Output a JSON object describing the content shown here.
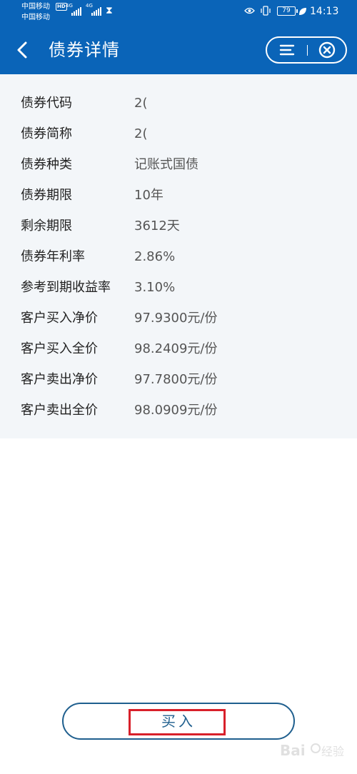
{
  "status_bar": {
    "carrier_1": "中国移动",
    "carrier_1_badge": "HD",
    "carrier_2": "中国移动",
    "signal_1_label": "4G",
    "signal_2_label": "4G",
    "battery_level": "79",
    "time": "14:13"
  },
  "header": {
    "title": "债券详情",
    "background_color": "#0a64b8",
    "icons": [
      "back-arrow-icon",
      "menu-icon",
      "close-circle-icon"
    ]
  },
  "bond_details": {
    "rows": [
      {
        "label": "债券代码",
        "value": "2("
      },
      {
        "label": "债券简称",
        "value": "2("
      },
      {
        "label": "债券种类",
        "value": "记账式国债"
      },
      {
        "label": "债券期限",
        "value": "10年"
      },
      {
        "label": "剩余期限",
        "value": "3612天"
      },
      {
        "label": "债券年利率",
        "value": "2.86%"
      },
      {
        "label": "参考到期收益率",
        "value": "3.10%"
      },
      {
        "label": "客户买入净价",
        "value": "97.9300元/份"
      },
      {
        "label": "客户买入全价",
        "value": "98.2409元/份"
      },
      {
        "label": "客户卖出净价",
        "value": "97.7800元/份"
      },
      {
        "label": "客户卖出全价",
        "value": "98.0909元/份"
      }
    ]
  },
  "actions": {
    "buy_label": "买入",
    "highlight_color": "#d8202a"
  },
  "watermark": {
    "text": "Bai经验"
  }
}
